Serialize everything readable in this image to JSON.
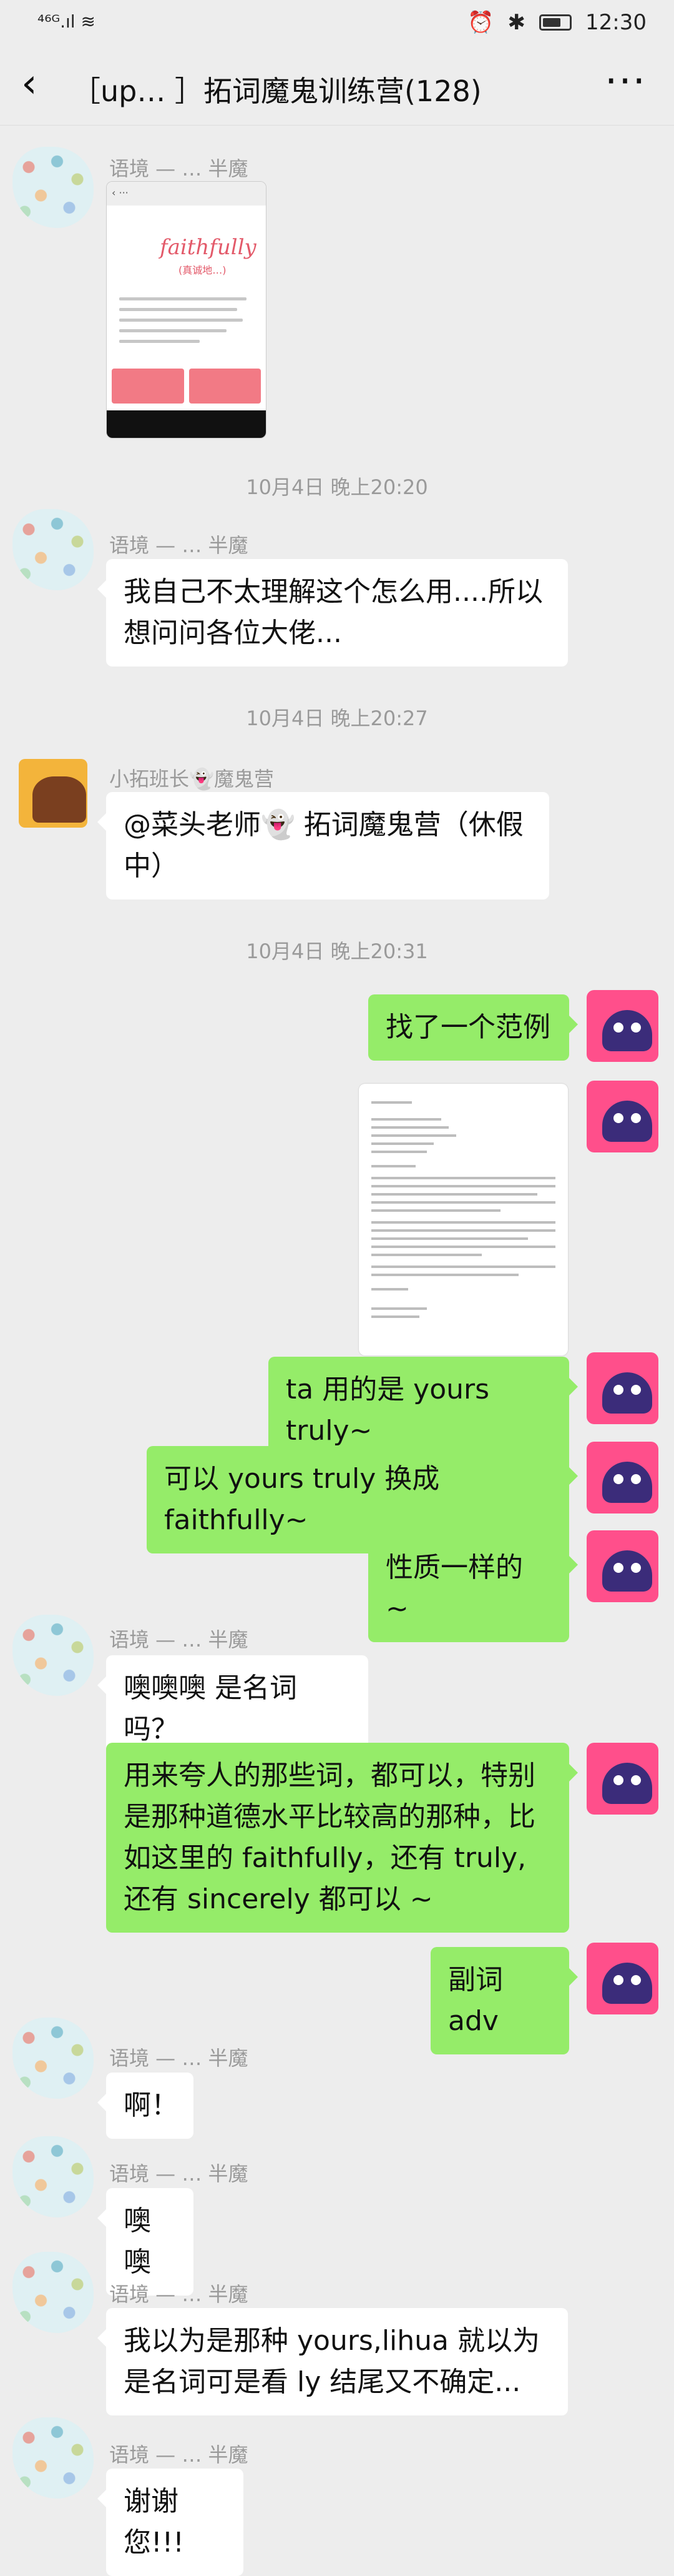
{
  "status": {
    "carrier": "⁴⁶ᴳ.ıl  ≋",
    "time": "12:30",
    "battery": 0.7
  },
  "nav": {
    "title": "［up… ］拓词魔鬼训练营(128)"
  },
  "chat": {
    "nick_yujing": "语境 — … 半魔",
    "nick_monitor": "小拓班长👻魔鬼营",
    "shot": {
      "script": "faithfully",
      "sub": "(真诚地…)"
    },
    "t1": "10月4日 晚上20:20",
    "m1": "我自己不太理解这个怎么用....所以想问问各位大佬...",
    "t2": "10月4日 晚上20:27",
    "m2": "@菜头老师👻 拓词魔鬼营（休假中）",
    "t3": "10月4日 晚上20:31",
    "r1": "找了一个范例",
    "r2": "ta 用的是 yours truly~",
    "r3": "可以 yours truly 换成 faithfully~",
    "r4": "性质一样的 ~",
    "m3": "噢噢噢 是名词吗？",
    "r5": "用来夸人的那些词，都可以，特别是那种道德水平比较高的那种，比如这里的 faithfully，还有 truly, 还有 sincerely 都可以 ~",
    "r6": "副词 adv",
    "m4": "啊！",
    "m5": "噢噢",
    "m6": "我以为是那种 yours,lihua 就以为是名词可是看 ly 结尾又不确定...",
    "m7": "谢谢您!!!"
  }
}
